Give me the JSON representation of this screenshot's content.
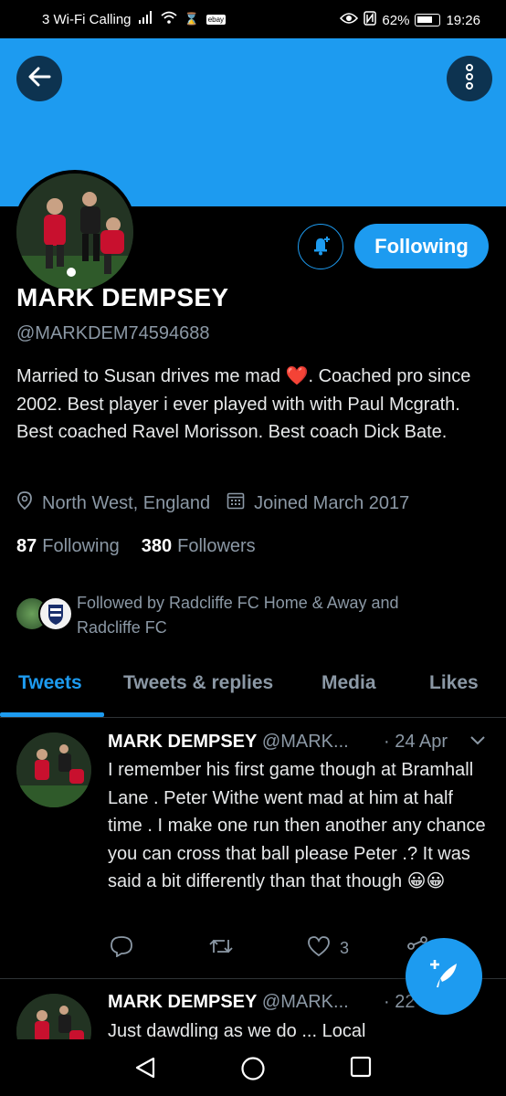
{
  "status_bar": {
    "carrier": "3 Wi-Fi Calling",
    "ebay": "ebay",
    "battery": "62%",
    "time": "19:26"
  },
  "header": {
    "back_icon": "arrow-left-icon",
    "more_icon": "more-vertical-icon"
  },
  "profile": {
    "name": "MARK DEMPSEY",
    "handle": "@MARKDEM74594688",
    "bio_line1": "Married to Susan drives me mad ",
    "bio_heart": "❤️",
    "bio_line1b": ". Coached pro",
    "bio_rest": "since 2002. Best player i ever played with with Paul Mcgrath. Best coached Ravel Morisson. Best coach Dick Bate.",
    "location": "North West, England",
    "joined": "Joined March 2017",
    "following_count": "87",
    "following_label": "Following",
    "followers_count": "380",
    "followers_label": "Followers",
    "followed_by": "Followed by Radcliffe FC Home & Away and Radcliffe FC",
    "follow_button": "Following"
  },
  "tabs": [
    {
      "label": "Tweets",
      "active": true
    },
    {
      "label": "Tweets & replies",
      "active": false
    },
    {
      "label": "Media",
      "active": false
    },
    {
      "label": "Likes",
      "active": false
    }
  ],
  "tweets": [
    {
      "name": "MARK DEMPSEY",
      "handle": "@MARK...",
      "date": "· 24 Apr",
      "text": "I remember his first game though at Bramhall Lane . Peter Withe went mad at him at half time . I make one run then another any chance you can cross that ball please Peter .?   It was said a bit differently than that though 😀😀",
      "likes": "3"
    },
    {
      "name": "MARK DEMPSEY",
      "handle": "@MARK...",
      "date": "· 22",
      "text": "Just dawdling as we do ...  Local"
    }
  ],
  "colors": {
    "accent": "#1d9bf0",
    "background": "#000000",
    "secondary_text": "#8b98a5"
  }
}
